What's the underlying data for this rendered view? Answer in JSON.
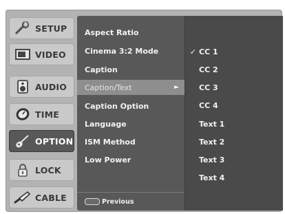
{
  "tabs": [
    {
      "label": "SETUP",
      "icon": "wrench-icon"
    },
    {
      "label": "VIDEO",
      "icon": "monitor-icon"
    },
    {
      "label": "AUDIO",
      "icon": "speaker-icon"
    },
    {
      "label": "TIME",
      "icon": "clock-icon"
    },
    {
      "label": "OPTION",
      "icon": "guitar-icon",
      "active": true
    },
    {
      "label": "LOCK",
      "icon": "padlock-icon"
    },
    {
      "label": "CABLE",
      "icon": "cable-plug-icon"
    }
  ],
  "menu": {
    "items": [
      {
        "label": "Aspect Ratio"
      },
      {
        "label": "Cinema 3:2 Mode"
      },
      {
        "label": "Caption"
      },
      {
        "label": "Caption/Text",
        "selected": true,
        "arrow": "►"
      },
      {
        "label": "Caption Option"
      },
      {
        "label": "Language"
      },
      {
        "label": "ISM Method"
      },
      {
        "label": "Low Power"
      }
    ],
    "previous_label": "Previous"
  },
  "submenu": {
    "checkmark": "✓",
    "items": [
      {
        "label": "CC 1",
        "checked": true
      },
      {
        "label": "CC 2"
      },
      {
        "label": "CC 3"
      },
      {
        "label": "CC 4"
      },
      {
        "label": "Text 1"
      },
      {
        "label": "Text 2"
      },
      {
        "label": "Text 3"
      },
      {
        "label": "Text 4"
      }
    ]
  },
  "colors": {
    "background": "#b3b3b3",
    "menu_panel": "#585858",
    "submenu_panel": "#4a4a4a",
    "selected_row": "#8e8e8e",
    "active_tab": "#585858"
  }
}
